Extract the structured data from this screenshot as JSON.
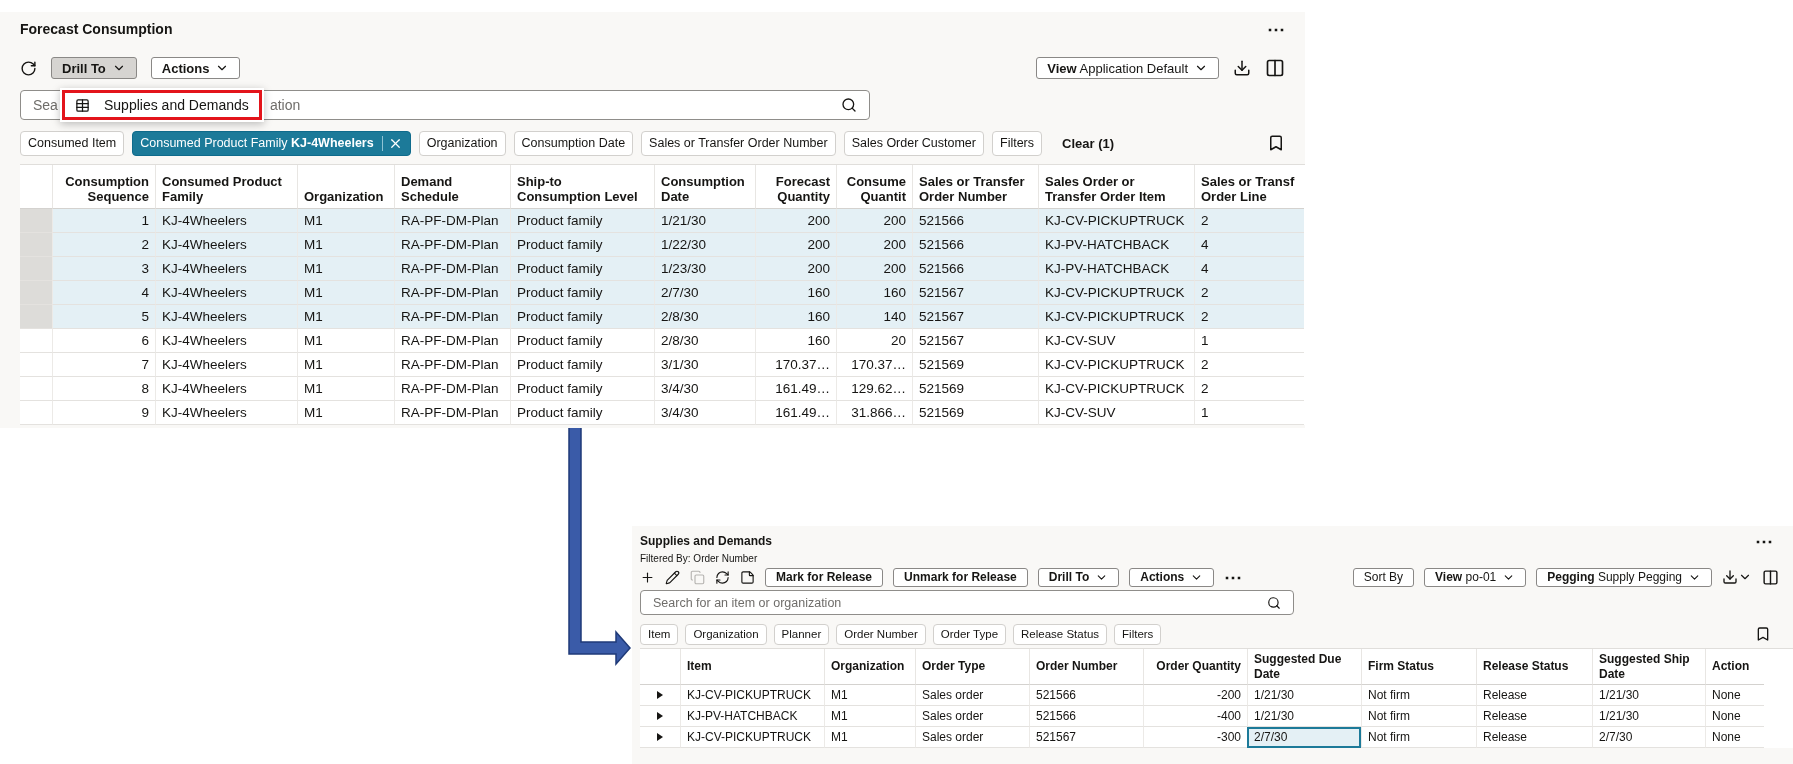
{
  "forecast": {
    "title": "Forecast Consumption",
    "more": "⋯",
    "toolbar": {
      "drill_to": "Drill To",
      "actions": "Actions",
      "view": "**View** Application Default"
    },
    "menu": [
      {
        "label": "Supplies and Demands"
      }
    ],
    "search": {
      "visible_text": [
        "Sea",
        "ation"
      ]
    },
    "chips": [
      {
        "label": "Consumed Item",
        "selected": false
      },
      {
        "label": "Consumed Product Family **KJ-4Wheelers**",
        "selected": true
      },
      {
        "label": "Organization",
        "selected": false
      },
      {
        "label": "Consumption Date",
        "selected": false
      },
      {
        "label": "Sales or Transfer Order Number",
        "selected": false
      },
      {
        "label": "Sales Order Customer",
        "selected": false
      },
      {
        "label": "Filters",
        "selected": false
      }
    ],
    "clear": "Clear (1)",
    "table": {
      "columns": [
        {
          "label": "Consumption Sequence",
          "kind": "number"
        },
        {
          "label": "Consumed Product Family",
          "kind": "text"
        },
        {
          "label": "Organization",
          "kind": "text"
        },
        {
          "label": "Demand Schedule",
          "kind": "text"
        },
        {
          "label": "Ship-to Consumption Level",
          "kind": "text"
        },
        {
          "label": "Consumption Date",
          "kind": "text"
        },
        {
          "label": "Forecast Quantity",
          "kind": "number"
        },
        {
          "label": "Consume Quantit",
          "kind": "number"
        },
        {
          "label": "Sales or Transfer Order Number",
          "kind": "text"
        },
        {
          "label": "Sales Order or Transfer Order Item",
          "kind": "text"
        },
        {
          "label": "Sales or Transf Order Line",
          "kind": "text"
        }
      ],
      "rows": [
        {
          "selected": true,
          "cells": [
            "1",
            "KJ-4Wheelers",
            "M1",
            "RA-PF-DM-Plan",
            "Product family",
            "1/21/30",
            "200",
            "200",
            "521566",
            "KJ-CV-PICKUPTRUCK",
            "2"
          ]
        },
        {
          "selected": true,
          "cells": [
            "2",
            "KJ-4Wheelers",
            "M1",
            "RA-PF-DM-Plan",
            "Product family",
            "1/22/30",
            "200",
            "200",
            "521566",
            "KJ-PV-HATCHBACK",
            "4"
          ]
        },
        {
          "selected": true,
          "cells": [
            "3",
            "KJ-4Wheelers",
            "M1",
            "RA-PF-DM-Plan",
            "Product family",
            "1/23/30",
            "200",
            "200",
            "521566",
            "KJ-PV-HATCHBACK",
            "4"
          ]
        },
        {
          "selected": true,
          "cells": [
            "4",
            "KJ-4Wheelers",
            "M1",
            "RA-PF-DM-Plan",
            "Product family",
            "2/7/30",
            "160",
            "160",
            "521567",
            "KJ-CV-PICKUPTRUCK",
            "2"
          ]
        },
        {
          "selected": true,
          "cells": [
            "5",
            "KJ-4Wheelers",
            "M1",
            "RA-PF-DM-Plan",
            "Product family",
            "2/8/30",
            "160",
            "140",
            "521567",
            "KJ-CV-PICKUPTRUCK",
            "2"
          ]
        },
        {
          "selected": false,
          "cells": [
            "6",
            "KJ-4Wheelers",
            "M1",
            "RA-PF-DM-Plan",
            "Product family",
            "2/8/30",
            "160",
            "20",
            "521567",
            "KJ-CV-SUV",
            "1"
          ]
        },
        {
          "selected": false,
          "cells": [
            "7",
            "KJ-4Wheelers",
            "M1",
            "RA-PF-DM-Plan",
            "Product family",
            "3/1/30",
            "170.37…",
            "170.37…",
            "521569",
            "KJ-CV-PICKUPTRUCK",
            "2"
          ]
        },
        {
          "selected": false,
          "cells": [
            "8",
            "KJ-4Wheelers",
            "M1",
            "RA-PF-DM-Plan",
            "Product family",
            "3/4/30",
            "161.49…",
            "129.62…",
            "521569",
            "KJ-CV-PICKUPTRUCK",
            "2"
          ]
        },
        {
          "selected": false,
          "cells": [
            "9",
            "KJ-4Wheelers",
            "M1",
            "RA-PF-DM-Plan",
            "Product family",
            "3/4/30",
            "161.49…",
            "31.866…",
            "521569",
            "KJ-CV-SUV",
            "1"
          ]
        }
      ]
    }
  },
  "supplies": {
    "title": "Supplies and Demands",
    "subtitle": "Filtered By: Order Number",
    "more": "⋯",
    "tools": [
      {
        "kind": "add",
        "disabled": false
      },
      {
        "kind": "edit",
        "disabled": false
      },
      {
        "kind": "duplicate",
        "disabled": true
      },
      {
        "kind": "refresh",
        "disabled": false
      },
      {
        "kind": "note",
        "disabled": false
      }
    ],
    "buttons": [
      {
        "label": "Mark for Release",
        "kind": "plain"
      },
      {
        "label": "Unmark for Release",
        "kind": "plain"
      },
      {
        "label": "Drill To",
        "kind": "menu"
      },
      {
        "label": "Actions",
        "kind": "menu"
      }
    ],
    "overflow": "⋯",
    "right_buttons": [
      {
        "label": "Sort By",
        "kind": "plain"
      },
      {
        "label": "**View** po-01",
        "kind": "menu"
      },
      {
        "label": "**Pegging** Supply Pegging",
        "kind": "menu"
      }
    ],
    "search": {
      "placeholder": "Search for an item or organization"
    },
    "chips": [
      {
        "label": "Item"
      },
      {
        "label": "Organization"
      },
      {
        "label": "Planner"
      },
      {
        "label": "Order Number"
      },
      {
        "label": "Order Type"
      },
      {
        "label": "Release Status"
      },
      {
        "label": "Filters"
      }
    ],
    "table": {
      "columns": [
        {
          "label": "Item",
          "kind": "text"
        },
        {
          "label": "Organization",
          "kind": "text"
        },
        {
          "label": "Order Type",
          "kind": "text"
        },
        {
          "label": "Order Number",
          "kind": "text"
        },
        {
          "label": "Order Quantity",
          "kind": "number"
        },
        {
          "label": "Suggested Due Date",
          "kind": "text"
        },
        {
          "label": "Firm Status",
          "kind": "text"
        },
        {
          "label": "Release Status",
          "kind": "text"
        },
        {
          "label": "Suggested Ship Date",
          "kind": "text"
        },
        {
          "label": "Action",
          "kind": "text"
        }
      ],
      "rows": [
        {
          "cells": [
            {
              "text": "KJ-CV-PICKUPTRUCK",
              "focused": false
            },
            {
              "text": "M1",
              "focused": false
            },
            {
              "text": "Sales order",
              "focused": false
            },
            {
              "text": "521566",
              "focused": false
            },
            {
              "text": "-200",
              "focused": false
            },
            {
              "text": "1/21/30",
              "focused": false
            },
            {
              "text": "Not firm",
              "focused": false
            },
            {
              "text": "Release",
              "focused": false
            },
            {
              "text": "1/21/30",
              "focused": false
            },
            {
              "text": "None",
              "focused": false
            }
          ]
        },
        {
          "cells": [
            {
              "text": "KJ-PV-HATCHBACK",
              "focused": false
            },
            {
              "text": "M1",
              "focused": false
            },
            {
              "text": "Sales order",
              "focused": false
            },
            {
              "text": "521566",
              "focused": false
            },
            {
              "text": "-400",
              "focused": false
            },
            {
              "text": "1/21/30",
              "focused": false
            },
            {
              "text": "Not firm",
              "focused": false
            },
            {
              "text": "Release",
              "focused": false
            },
            {
              "text": "1/21/30",
              "focused": false
            },
            {
              "text": "None",
              "focused": false
            }
          ]
        },
        {
          "cells": [
            {
              "text": "KJ-CV-PICKUPTRUCK",
              "focused": false
            },
            {
              "text": "M1",
              "focused": false
            },
            {
              "text": "Sales order",
              "focused": false
            },
            {
              "text": "521567",
              "focused": false
            },
            {
              "text": "-300",
              "focused": false
            },
            {
              "text": "2/7/30",
              "focused": true
            },
            {
              "text": "Not firm",
              "focused": false
            },
            {
              "text": "Release",
              "focused": false
            },
            {
              "text": "2/7/30",
              "focused": false
            },
            {
              "text": "None",
              "focused": false
            }
          ]
        }
      ]
    }
  }
}
